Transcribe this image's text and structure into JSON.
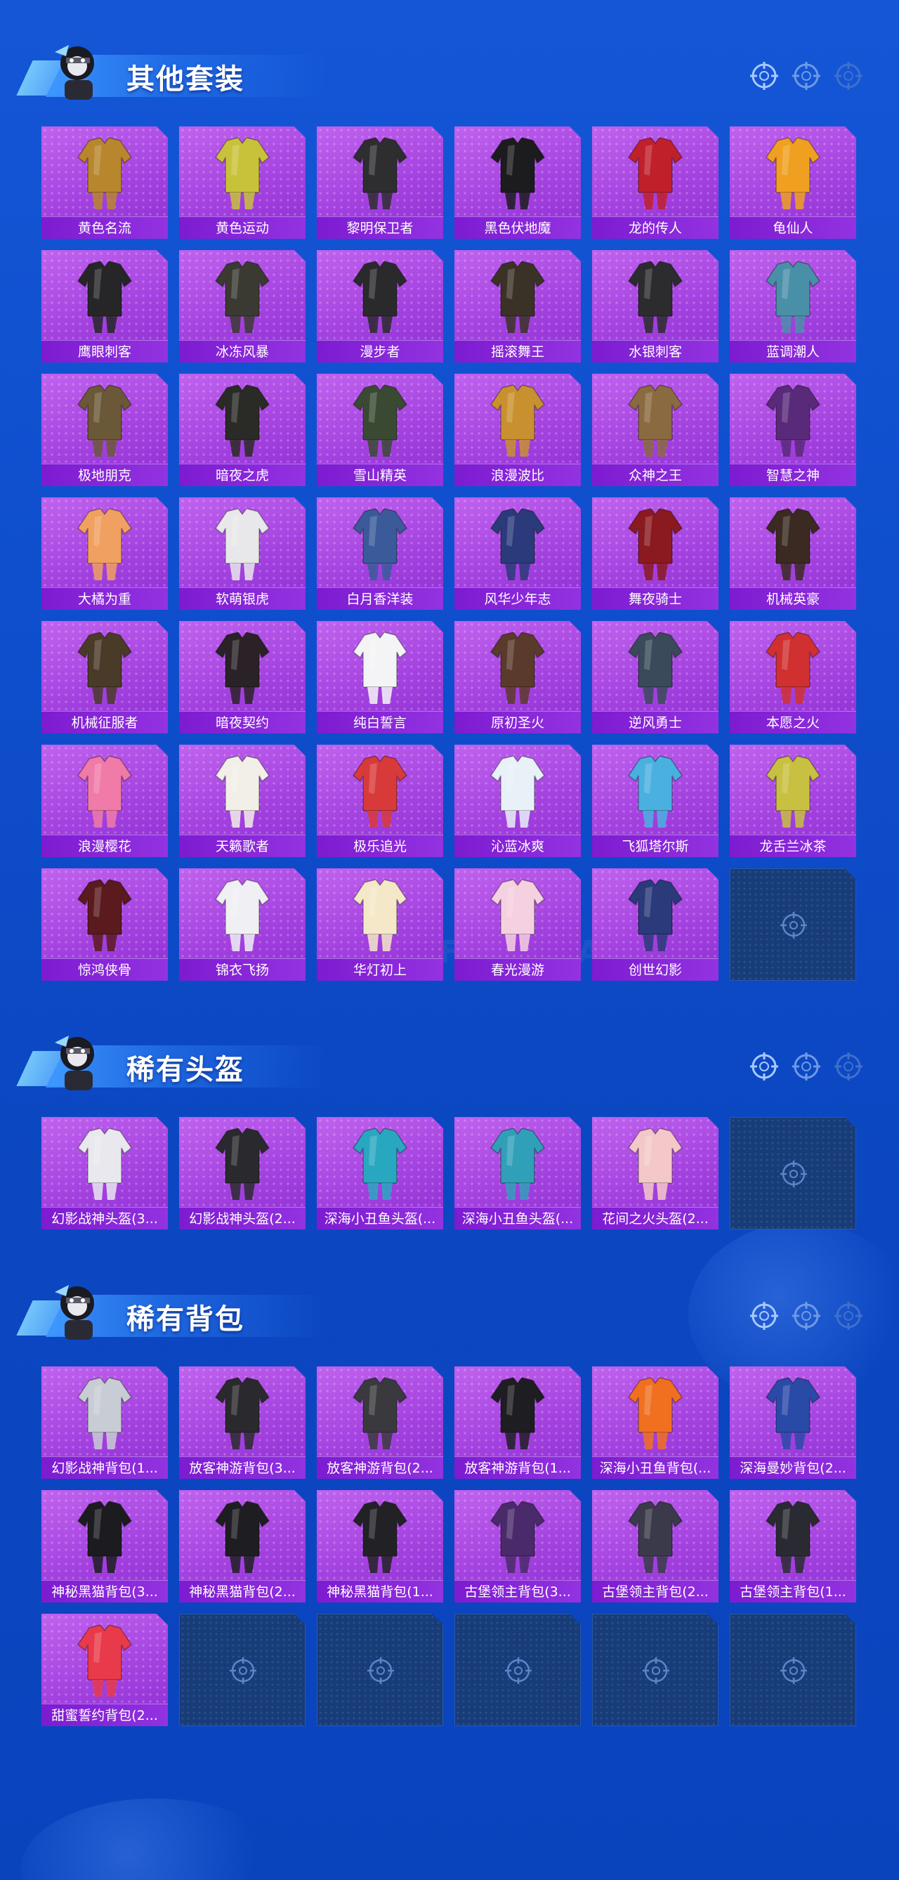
{
  "sections": {
    "outfits": {
      "title": "其他套装",
      "items": [
        {
          "name": "黄色名流",
          "color": "#b8862d"
        },
        {
          "name": "黄色运动",
          "color": "#c8c23a"
        },
        {
          "name": "黎明保卫者",
          "color": "#2e2e30"
        },
        {
          "name": "黑色伏地魔",
          "color": "#1c1c1e"
        },
        {
          "name": "龙的传人",
          "color": "#c0202a"
        },
        {
          "name": "龟仙人",
          "color": "#f0a020"
        },
        {
          "name": "鹰眼刺客",
          "color": "#262628"
        },
        {
          "name": "冰冻风暴",
          "color": "#3a3a32"
        },
        {
          "name": "漫步者",
          "color": "#2a2a2c"
        },
        {
          "name": "摇滚舞王",
          "color": "#3a3226"
        },
        {
          "name": "水银刺客",
          "color": "#2c2c2e"
        },
        {
          "name": "蓝调潮人",
          "color": "#4a8fa8"
        },
        {
          "name": "极地朋克",
          "color": "#6b5838"
        },
        {
          "name": "暗夜之虎",
          "color": "#2a2a26"
        },
        {
          "name": "雪山精英",
          "color": "#3a4a32"
        },
        {
          "name": "浪漫波比",
          "color": "#c8902e"
        },
        {
          "name": "众神之王",
          "color": "#8a6a40"
        },
        {
          "name": "智慧之神",
          "color": "#5a2a7a"
        },
        {
          "name": "大橘为重",
          "color": "#f0a060"
        },
        {
          "name": "软萌银虎",
          "color": "#e8e8ea"
        },
        {
          "name": "白月香洋装",
          "color": "#3a5a9a"
        },
        {
          "name": "风华少年志",
          "color": "#2a3a7a"
        },
        {
          "name": "舞夜骑士",
          "color": "#8a1a20"
        },
        {
          "name": "机械英豪",
          "color": "#3a2a22"
        },
        {
          "name": "机械征服者",
          "color": "#4a3a28"
        },
        {
          "name": "暗夜契约",
          "color": "#2a2226"
        },
        {
          "name": "纯白誓言",
          "color": "#f4f4f6"
        },
        {
          "name": "原初圣火",
          "color": "#5a3a2a"
        },
        {
          "name": "逆风勇士",
          "color": "#3a4a5a"
        },
        {
          "name": "本愿之火",
          "color": "#d03030"
        },
        {
          "name": "浪漫樱花",
          "color": "#f07aa8"
        },
        {
          "name": "天籁歌者",
          "color": "#f2efe8"
        },
        {
          "name": "极乐追光",
          "color": "#d83a3a"
        },
        {
          "name": "沁蓝冰爽",
          "color": "#e8f0f8"
        },
        {
          "name": "飞狐塔尔斯",
          "color": "#4ab0e0"
        },
        {
          "name": "龙舌兰冰茶",
          "color": "#c8c040"
        },
        {
          "name": "惊鸿侠骨",
          "color": "#5a1a1e"
        },
        {
          "name": "锦衣飞扬",
          "color": "#f0f0f4"
        },
        {
          "name": "华灯初上",
          "color": "#f4e8c8"
        },
        {
          "name": "春光漫游",
          "color": "#f4d0e0"
        },
        {
          "name": "创世幻影",
          "color": "#2a3a7a"
        }
      ]
    },
    "helmets": {
      "title": "稀有头盔",
      "items": [
        {
          "name": "幻影战神头盔(3...",
          "color": "#e8e8ee"
        },
        {
          "name": "幻影战神头盔(2...",
          "color": "#2a2a2e"
        },
        {
          "name": "深海小丑鱼头盔(...",
          "color": "#28a8c0"
        },
        {
          "name": "深海小丑鱼头盔(...",
          "color": "#30a0b8"
        },
        {
          "name": "花间之火头盔(2...",
          "color": "#f4c8c8"
        }
      ]
    },
    "backpacks": {
      "title": "稀有背包",
      "items": [
        {
          "name": "幻影战神背包(1...",
          "color": "#c8ccd4"
        },
        {
          "name": "放客神游背包(3...",
          "color": "#2a2a2e"
        },
        {
          "name": "放客神游背包(2...",
          "color": "#3a3a3e"
        },
        {
          "name": "放客神游背包(1...",
          "color": "#1e1e22"
        },
        {
          "name": "深海小丑鱼背包(...",
          "color": "#f07020"
        },
        {
          "name": "深海曼妙背包(2...",
          "color": "#2a4aa8"
        },
        {
          "name": "神秘黑猫背包(3...",
          "color": "#1c1c20"
        },
        {
          "name": "神秘黑猫背包(2...",
          "color": "#1e1e22"
        },
        {
          "name": "神秘黑猫背包(1...",
          "color": "#222226"
        },
        {
          "name": "古堡领主背包(3...",
          "color": "#4a2a6a"
        },
        {
          "name": "古堡领主背包(2...",
          "color": "#3a3a4a"
        },
        {
          "name": "古堡领主背包(1...",
          "color": "#2a2a32"
        },
        {
          "name": "甜蜜誓约背包(2...",
          "color": "#e83a4a"
        }
      ]
    }
  },
  "icons": {
    "header_target": "crosshair-icon",
    "empty_slot": "crosshair-icon",
    "mascot": "mascot-icon"
  },
  "colors": {
    "background": "#0f4fce",
    "card": "#a442e0",
    "label_bar": "#8a28dc",
    "empty_slot": "#183c78"
  }
}
